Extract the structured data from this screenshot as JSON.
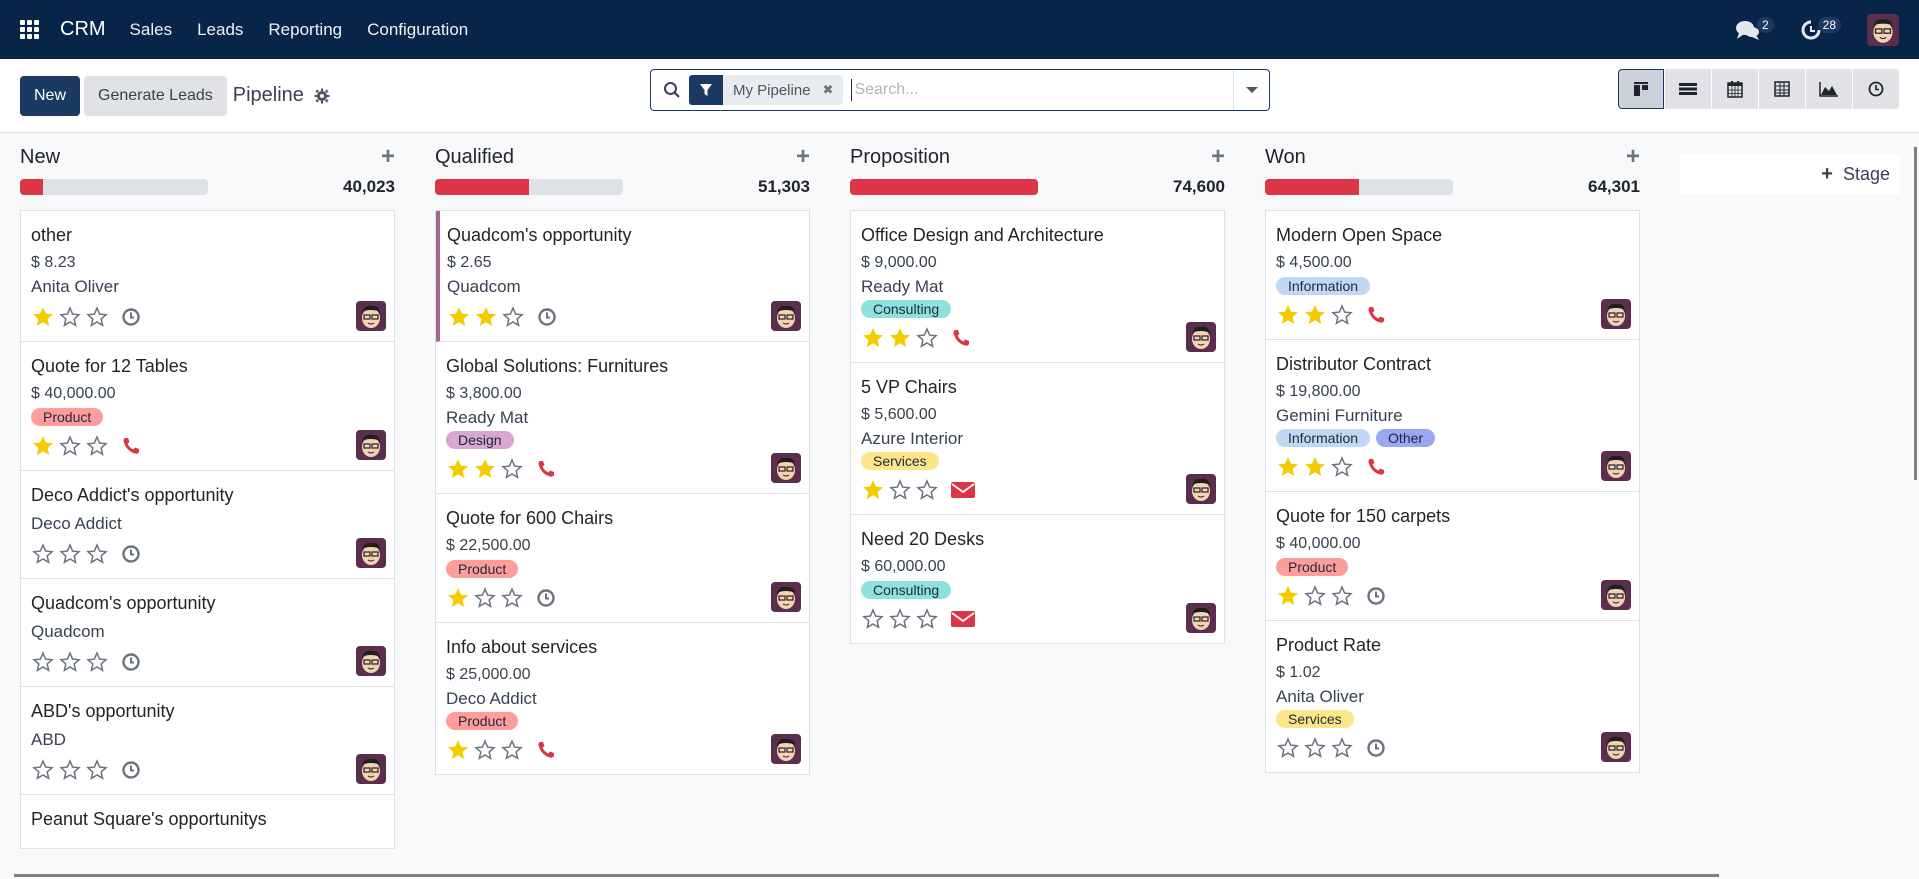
{
  "navbar": {
    "brand": "CRM",
    "menu": [
      "Sales",
      "Leads",
      "Reporting",
      "Configuration"
    ],
    "messages_count": "2",
    "activities_count": "28"
  },
  "control_panel": {
    "new_label": "New",
    "generate_label": "Generate Leads",
    "title": "Pipeline",
    "search": {
      "facet_label": "My Pipeline",
      "placeholder": "Search...",
      "value": ""
    },
    "views": [
      "kanban",
      "list",
      "calendar",
      "pivot",
      "graph",
      "activity"
    ],
    "active_view": "kanban"
  },
  "colors": {
    "brand": "#072549",
    "primary": "#1b3a63",
    "danger": "#dc3545",
    "star": "#f3cc00",
    "highlight_border": "#a3668c"
  },
  "tag_colors": {
    "Product": "#ff9d9d",
    "Design": "#d9a7d4",
    "Consulting": "#8ee2dd",
    "Services": "#fde58a",
    "Information": "#bfd9f5",
    "Other": "#9aa7f5"
  },
  "columns": [
    {
      "title": "New",
      "total": "40,023",
      "progress": 0.12,
      "cards": [
        {
          "title": "other",
          "amount": "$ 8.23",
          "partner": "Anita Oliver",
          "tags": [],
          "stars": 1,
          "activity": "clock"
        },
        {
          "title": "Quote for 12 Tables",
          "amount": "$ 40,000.00",
          "partner": "",
          "tags": [
            "Product"
          ],
          "stars": 1,
          "activity": "phone"
        },
        {
          "title": "Deco Addict's opportunity",
          "amount": "",
          "partner": "Deco Addict",
          "tags": [],
          "stars": 0,
          "activity": "clock"
        },
        {
          "title": "Quadcom's opportunity",
          "amount": "",
          "partner": "Quadcom",
          "tags": [],
          "stars": 0,
          "activity": "clock"
        },
        {
          "title": "ABD's opportunity",
          "amount": "",
          "partner": "ABD",
          "tags": [],
          "stars": 0,
          "activity": "clock"
        },
        {
          "title": "Peanut Square's opportunitys",
          "amount": "",
          "partner": "",
          "tags": [],
          "stars": 0,
          "activity": "none"
        }
      ]
    },
    {
      "title": "Qualified",
      "total": "51,303",
      "progress": 0.5,
      "cards": [
        {
          "title": "Quadcom's opportunity",
          "amount": "$ 2.65",
          "partner": "Quadcom",
          "tags": [],
          "stars": 2,
          "activity": "clock",
          "highlight": true
        },
        {
          "title": "Global Solutions: Furnitures",
          "amount": "$ 3,800.00",
          "partner": "Ready Mat",
          "tags": [
            "Design"
          ],
          "stars": 2,
          "activity": "phone"
        },
        {
          "title": "Quote for 600 Chairs",
          "amount": "$ 22,500.00",
          "partner": "",
          "tags": [
            "Product"
          ],
          "stars": 1,
          "activity": "clock"
        },
        {
          "title": "Info about services",
          "amount": "$ 25,000.00",
          "partner": "Deco Addict",
          "tags": [
            "Product"
          ],
          "stars": 1,
          "activity": "phone"
        }
      ]
    },
    {
      "title": "Proposition",
      "total": "74,600",
      "progress": 1.0,
      "cards": [
        {
          "title": "Office Design and Architecture",
          "amount": "$ 9,000.00",
          "partner": "Ready Mat",
          "tags": [
            "Consulting"
          ],
          "stars": 2,
          "activity": "phone"
        },
        {
          "title": "5 VP Chairs",
          "amount": "$ 5,600.00",
          "partner": "Azure Interior",
          "tags": [
            "Services"
          ],
          "stars": 1,
          "activity": "email"
        },
        {
          "title": "Need 20 Desks",
          "amount": "$ 60,000.00",
          "partner": "",
          "tags": [
            "Consulting"
          ],
          "stars": 0,
          "activity": "email"
        }
      ]
    },
    {
      "title": "Won",
      "total": "64,301",
      "progress": 0.5,
      "cards": [
        {
          "title": "Modern Open Space",
          "amount": "$ 4,500.00",
          "partner": "",
          "tags": [
            "Information"
          ],
          "stars": 2,
          "activity": "phone"
        },
        {
          "title": "Distributor Contract",
          "amount": "$ 19,800.00",
          "partner": "Gemini Furniture",
          "tags": [
            "Information",
            "Other"
          ],
          "stars": 2,
          "activity": "phone"
        },
        {
          "title": "Quote for 150 carpets",
          "amount": "$ 40,000.00",
          "partner": "",
          "tags": [
            "Product"
          ],
          "stars": 1,
          "activity": "clock"
        },
        {
          "title": "Product Rate",
          "amount": "$ 1.02",
          "partner": "Anita Oliver",
          "tags": [
            "Services"
          ],
          "stars": 0,
          "activity": "clock"
        }
      ]
    }
  ],
  "add_stage_label": "Stage"
}
